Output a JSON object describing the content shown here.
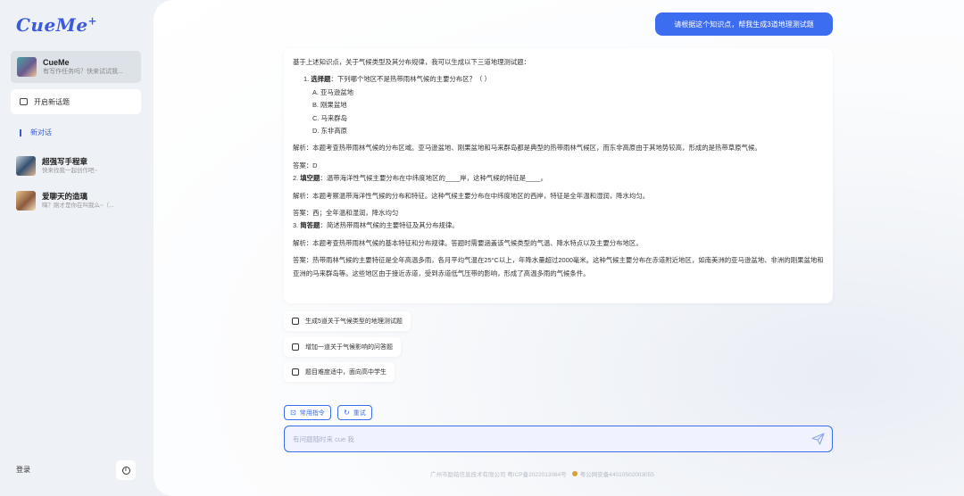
{
  "app": {
    "logo": "CueMe",
    "logo_mark": "+"
  },
  "sidebar": {
    "profile": {
      "name": "CueMe",
      "subtitle": "有写作任务吗？快来试试我..."
    },
    "new_topic_label": "开启新话题",
    "new_chat_label": "新对话",
    "chats": [
      {
        "title": "超强写手程章",
        "subtitle": "快来找我一起创作吧~"
      },
      {
        "title": "爱聊天的造璃",
        "subtitle": "嗨？刚才是你在叫我么~（..."
      }
    ],
    "login_label": "登录",
    "info_symbol": "i"
  },
  "conversation": {
    "user_message": "请根据这个知识点，帮我生成3道地理测试题",
    "answer": {
      "intro": "基于上述知识点，关于气候类型及其分布规律，我可以生成以下三道地理测试题：",
      "q1_num": "1.",
      "q1_type": "选择题",
      "q1_text": "：下列哪个地区不是热带雨林气候的主要分布区？（    ）",
      "q1_options": [
        "A. 亚马逊盆地",
        "B. 刚果盆地",
        "C. 马来群岛",
        "D. 东非高原"
      ],
      "q1_analysis": "解析：本题考查热带雨林气候的分布区域。亚马逊盆地、刚果盆地和马来群岛都是典型的热带雨林气候区，而东非高原由于其地势较高，形成的是热带草原气候。",
      "q1_answer": "答案：D",
      "q2_num": "2.",
      "q2_type": "填空题",
      "q2_text": "：温带海洋性气候主要分布在中纬度地区的____岸，这种气候的特征是____。",
      "q2_analysis": "解析：本题考察温带海洋性气候的分布和特征。这种气候主要分布在中纬度地区的西岸，特征是全年温和湿润，降水均匀。",
      "q2_answer": "答案：西；全年温和湿润，降水均匀",
      "q3_num": "3.",
      "q3_type": "简答题",
      "q3_text": "：简述热带雨林气候的主要特征及其分布规律。",
      "q3_analysis": "解析：本题考查热带雨林气候的基本特征和分布规律。答题时需要涵盖该气候类型的气温、降水特点以及主要分布地区。",
      "q3_answer": "答案：热带雨林气候的主要特征是全年高温多雨，各月平均气温在25°C以上，年降水量超过2000毫米。这种气候主要分布在赤道附近地区，如南美洲的亚马逊盆地、非洲的刚果盆地和亚洲的马来群岛等。这些地区由于接近赤道，受到赤道低气压带的影响，形成了高温多雨的气候条件。"
    },
    "suggestions": [
      "生成5道关于气候类型的地理测试题",
      "增加一道关于气候影响的问答题",
      "题目难度适中，面向高中学生"
    ]
  },
  "toolbar": {
    "commands_label": "常用指令",
    "retry_label": "重试"
  },
  "input": {
    "placeholder": "有问题随时来 cue 我"
  },
  "footer": {
    "company": "广州市励铭信息技术有限公司 粤ICP备2022013084号",
    "police": "粤公网安备44010502003055"
  },
  "colors": {
    "accent": "#3c6cf0",
    "sidebar_bg": "#eef1f5"
  }
}
